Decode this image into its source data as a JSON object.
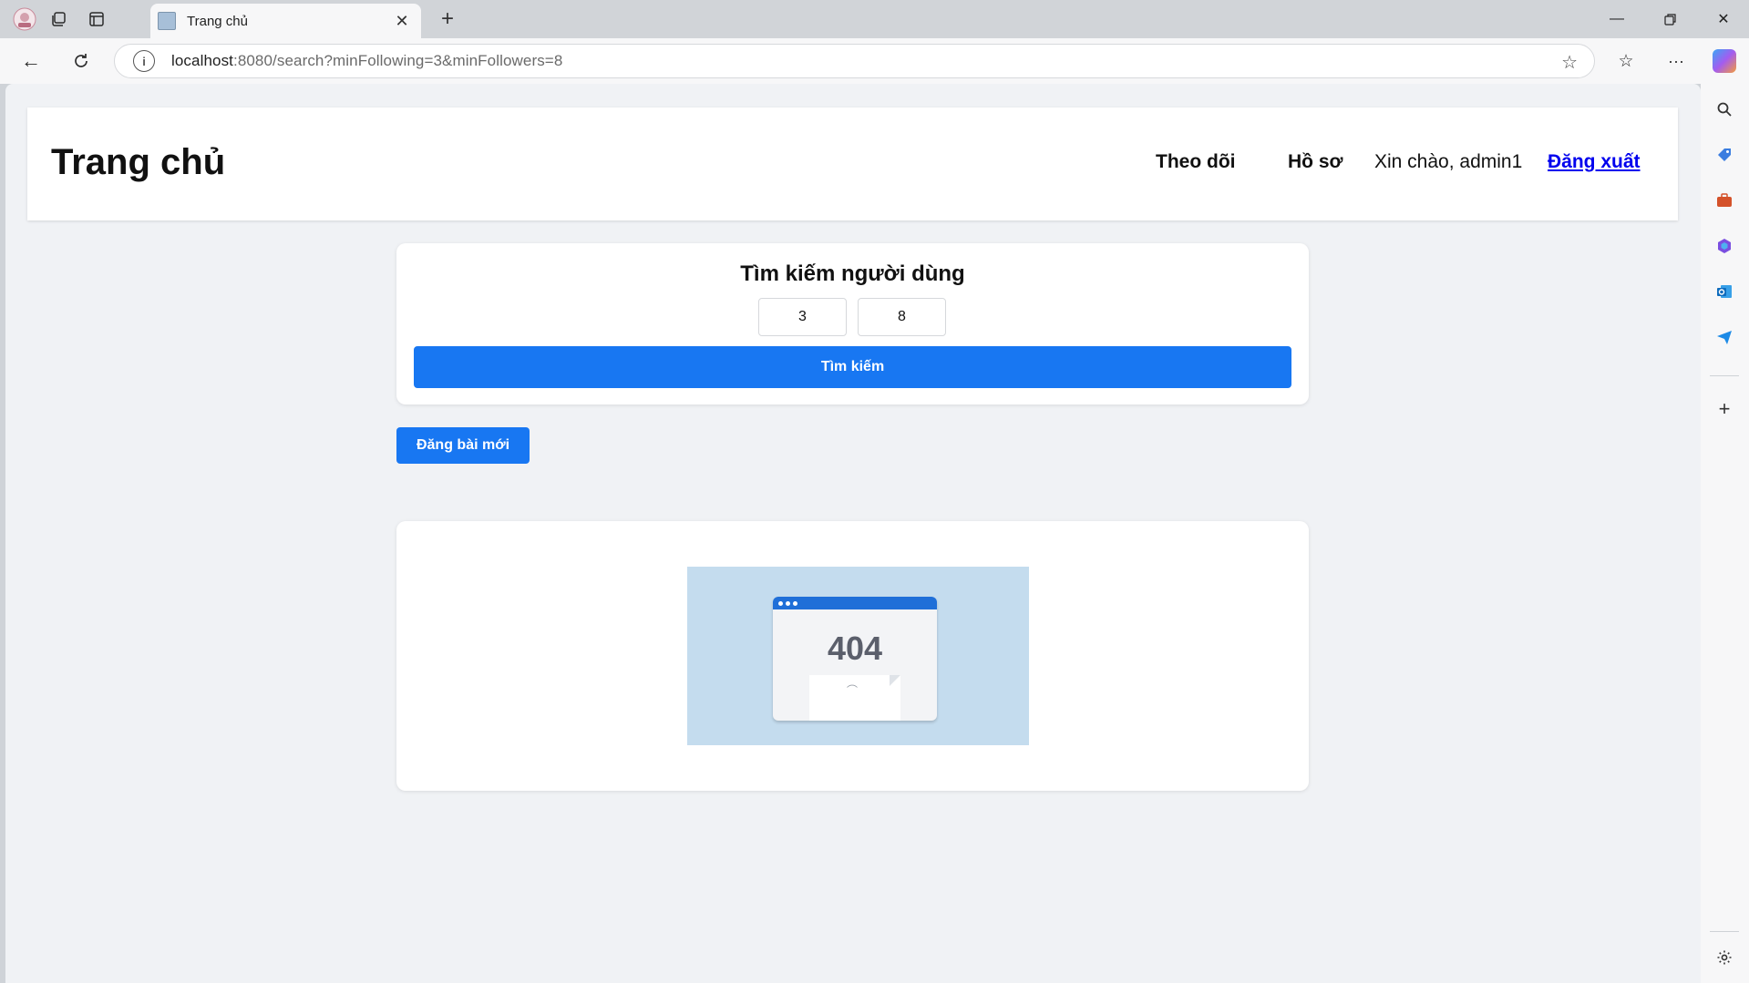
{
  "browser": {
    "tab_title": "Trang chủ",
    "url_host": "localhost",
    "url_rest": ":8080/search?minFollowing=3&minFollowers=8"
  },
  "header": {
    "site_title": "Trang chủ",
    "nav_following": "Theo dõi",
    "nav_profile": "Hồ sơ",
    "greeting": "Xin chào, admin1",
    "logout": "Đăng xuất"
  },
  "search": {
    "title": "Tìm kiếm người dùng",
    "min_following": "3",
    "min_followers": "8",
    "button": "Tìm kiếm"
  },
  "actions": {
    "new_post": "Đăng bài mới"
  },
  "post": {
    "image_text": "404"
  },
  "colors": {
    "accent": "#1877f2",
    "page_bg": "#f0f2f5",
    "link": "#0000ee"
  }
}
